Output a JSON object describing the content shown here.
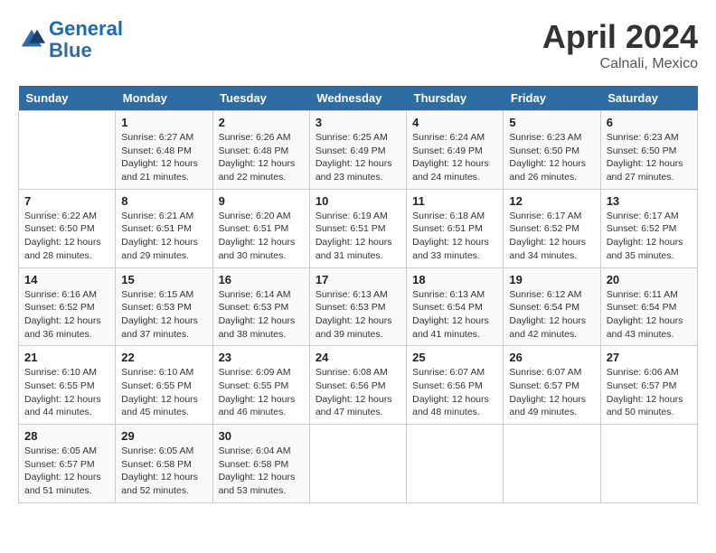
{
  "logo": {
    "line1": "General",
    "line2": "Blue"
  },
  "title": "April 2024",
  "location": "Calnali, Mexico",
  "days_header": [
    "Sunday",
    "Monday",
    "Tuesday",
    "Wednesday",
    "Thursday",
    "Friday",
    "Saturday"
  ],
  "weeks": [
    [
      {
        "num": "",
        "info": ""
      },
      {
        "num": "1",
        "info": "Sunrise: 6:27 AM\nSunset: 6:48 PM\nDaylight: 12 hours\nand 21 minutes."
      },
      {
        "num": "2",
        "info": "Sunrise: 6:26 AM\nSunset: 6:48 PM\nDaylight: 12 hours\nand 22 minutes."
      },
      {
        "num": "3",
        "info": "Sunrise: 6:25 AM\nSunset: 6:49 PM\nDaylight: 12 hours\nand 23 minutes."
      },
      {
        "num": "4",
        "info": "Sunrise: 6:24 AM\nSunset: 6:49 PM\nDaylight: 12 hours\nand 24 minutes."
      },
      {
        "num": "5",
        "info": "Sunrise: 6:23 AM\nSunset: 6:50 PM\nDaylight: 12 hours\nand 26 minutes."
      },
      {
        "num": "6",
        "info": "Sunrise: 6:23 AM\nSunset: 6:50 PM\nDaylight: 12 hours\nand 27 minutes."
      }
    ],
    [
      {
        "num": "7",
        "info": "Sunrise: 6:22 AM\nSunset: 6:50 PM\nDaylight: 12 hours\nand 28 minutes."
      },
      {
        "num": "8",
        "info": "Sunrise: 6:21 AM\nSunset: 6:51 PM\nDaylight: 12 hours\nand 29 minutes."
      },
      {
        "num": "9",
        "info": "Sunrise: 6:20 AM\nSunset: 6:51 PM\nDaylight: 12 hours\nand 30 minutes."
      },
      {
        "num": "10",
        "info": "Sunrise: 6:19 AM\nSunset: 6:51 PM\nDaylight: 12 hours\nand 31 minutes."
      },
      {
        "num": "11",
        "info": "Sunrise: 6:18 AM\nSunset: 6:51 PM\nDaylight: 12 hours\nand 33 minutes."
      },
      {
        "num": "12",
        "info": "Sunrise: 6:17 AM\nSunset: 6:52 PM\nDaylight: 12 hours\nand 34 minutes."
      },
      {
        "num": "13",
        "info": "Sunrise: 6:17 AM\nSunset: 6:52 PM\nDaylight: 12 hours\nand 35 minutes."
      }
    ],
    [
      {
        "num": "14",
        "info": "Sunrise: 6:16 AM\nSunset: 6:52 PM\nDaylight: 12 hours\nand 36 minutes."
      },
      {
        "num": "15",
        "info": "Sunrise: 6:15 AM\nSunset: 6:53 PM\nDaylight: 12 hours\nand 37 minutes."
      },
      {
        "num": "16",
        "info": "Sunrise: 6:14 AM\nSunset: 6:53 PM\nDaylight: 12 hours\nand 38 minutes."
      },
      {
        "num": "17",
        "info": "Sunrise: 6:13 AM\nSunset: 6:53 PM\nDaylight: 12 hours\nand 39 minutes."
      },
      {
        "num": "18",
        "info": "Sunrise: 6:13 AM\nSunset: 6:54 PM\nDaylight: 12 hours\nand 41 minutes."
      },
      {
        "num": "19",
        "info": "Sunrise: 6:12 AM\nSunset: 6:54 PM\nDaylight: 12 hours\nand 42 minutes."
      },
      {
        "num": "20",
        "info": "Sunrise: 6:11 AM\nSunset: 6:54 PM\nDaylight: 12 hours\nand 43 minutes."
      }
    ],
    [
      {
        "num": "21",
        "info": "Sunrise: 6:10 AM\nSunset: 6:55 PM\nDaylight: 12 hours\nand 44 minutes."
      },
      {
        "num": "22",
        "info": "Sunrise: 6:10 AM\nSunset: 6:55 PM\nDaylight: 12 hours\nand 45 minutes."
      },
      {
        "num": "23",
        "info": "Sunrise: 6:09 AM\nSunset: 6:55 PM\nDaylight: 12 hours\nand 46 minutes."
      },
      {
        "num": "24",
        "info": "Sunrise: 6:08 AM\nSunset: 6:56 PM\nDaylight: 12 hours\nand 47 minutes."
      },
      {
        "num": "25",
        "info": "Sunrise: 6:07 AM\nSunset: 6:56 PM\nDaylight: 12 hours\nand 48 minutes."
      },
      {
        "num": "26",
        "info": "Sunrise: 6:07 AM\nSunset: 6:57 PM\nDaylight: 12 hours\nand 49 minutes."
      },
      {
        "num": "27",
        "info": "Sunrise: 6:06 AM\nSunset: 6:57 PM\nDaylight: 12 hours\nand 50 minutes."
      }
    ],
    [
      {
        "num": "28",
        "info": "Sunrise: 6:05 AM\nSunset: 6:57 PM\nDaylight: 12 hours\nand 51 minutes."
      },
      {
        "num": "29",
        "info": "Sunrise: 6:05 AM\nSunset: 6:58 PM\nDaylight: 12 hours\nand 52 minutes."
      },
      {
        "num": "30",
        "info": "Sunrise: 6:04 AM\nSunset: 6:58 PM\nDaylight: 12 hours\nand 53 minutes."
      },
      {
        "num": "",
        "info": ""
      },
      {
        "num": "",
        "info": ""
      },
      {
        "num": "",
        "info": ""
      },
      {
        "num": "",
        "info": ""
      }
    ]
  ]
}
